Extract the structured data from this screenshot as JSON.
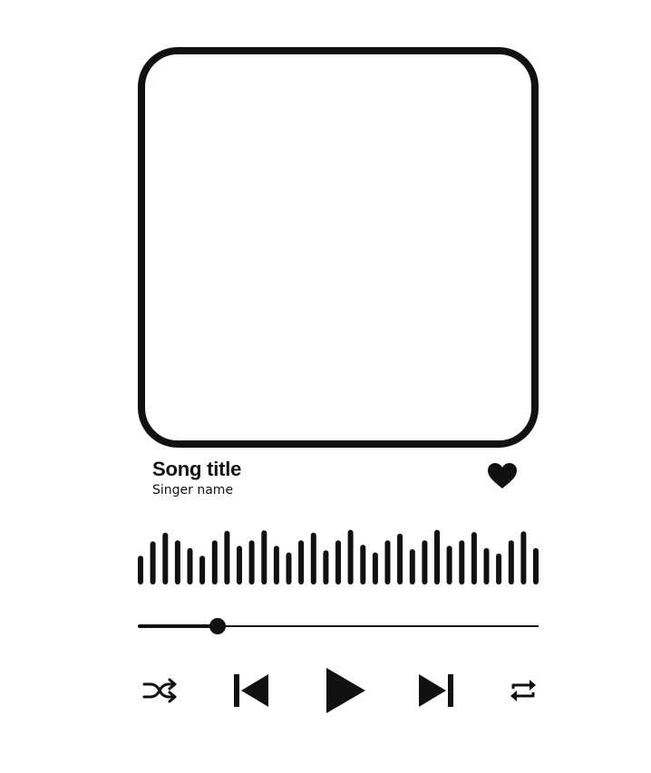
{
  "track": {
    "title": "Song title",
    "artist": "Singer name",
    "favorited": true
  },
  "waveform": {
    "levels": [
      0.52,
      0.78,
      0.94,
      0.8,
      0.66,
      0.52,
      0.8,
      0.97,
      0.7,
      0.8,
      0.98,
      0.7,
      0.58,
      0.8,
      0.94,
      0.62,
      0.8,
      0.99,
      0.72,
      0.58,
      0.8,
      0.92,
      0.64,
      0.8,
      0.99,
      0.7,
      0.8,
      0.95,
      0.66,
      0.56,
      0.8,
      0.96,
      0.66
    ]
  },
  "playback": {
    "progress": 0.2
  },
  "controls": {
    "shuffle_icon": "shuffle-icon",
    "previous_icon": "skip-previous-icon",
    "play_icon": "play-icon",
    "next_icon": "skip-next-icon",
    "repeat_icon": "repeat-icon"
  },
  "colors": {
    "foreground": "#111111",
    "background": "#ffffff"
  }
}
